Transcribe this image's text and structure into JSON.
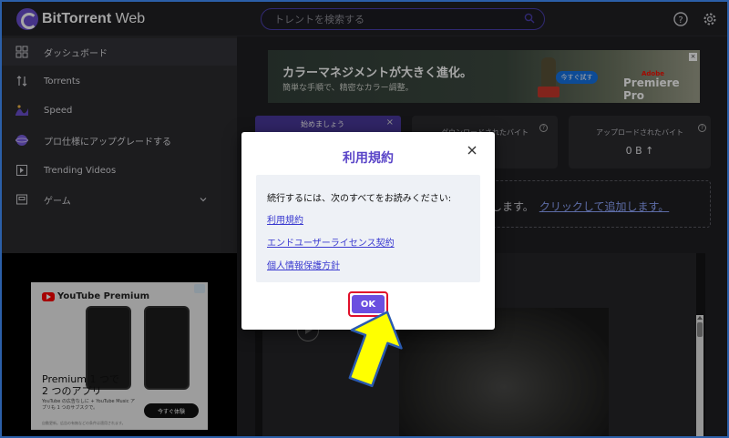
{
  "app": {
    "logo_bold": "BitTorrent",
    "logo_thin": "Web",
    "brand_color": "#6a4fd0"
  },
  "header": {
    "search_placeholder": "トレントを検索する",
    "icons": [
      "search-icon",
      "help-icon",
      "gear-icon"
    ]
  },
  "sidebar": {
    "items": [
      {
        "label": "ダッシュボード",
        "icon": "dashboard-icon",
        "active": true
      },
      {
        "label": "Torrents",
        "icon": "updown-arrows-icon"
      },
      {
        "label": "Speed",
        "icon": "speed-wave-icon"
      },
      {
        "label": "プロ仕様にアップグレードする",
        "icon": "pro-planet-icon"
      },
      {
        "label": "Trending Videos",
        "icon": "video-icon"
      },
      {
        "label": "ゲーム",
        "icon": "game-icon",
        "expandable": true
      }
    ]
  },
  "left_ad": {
    "logo_text": "YouTube Premium",
    "headline": "Premium 1 つで 2 つのアプリ",
    "sub_text": "YouTube の広告なしに + YouTube Music アプリも 1 つのサブスクで。",
    "cta": "今すぐ体験",
    "fine_print": "自動更新。広告の有無などの条件は適用されます。"
  },
  "top_ad": {
    "headline": "カラーマネジメントが大きく進化。",
    "subline": "簡単な手順で、精密なカラー調整。",
    "button": "今すぐ試す",
    "brand_small": "Adobe",
    "brand_large": "Premiere Pro"
  },
  "cards": {
    "start_label": "始めましょう",
    "download_label": "ダウンロードされたバイト",
    "upload_label": "アップロードされたバイト",
    "upload_value": "0 B ↑"
  },
  "dropzone": {
    "text": "します。",
    "link": "クリックして追加します。"
  },
  "modal": {
    "title": "利用規約",
    "intro": "続行するには、次のすべてをお読みください:",
    "links": [
      "利用規約",
      "エンドユーザーライセンス契約",
      "個人情報保護方針"
    ],
    "ok_label": "OK",
    "ok_color": "#6a4fe0",
    "highlight_color": "#e0102a"
  },
  "annotation": {
    "arrow_color": "#ffff00"
  }
}
